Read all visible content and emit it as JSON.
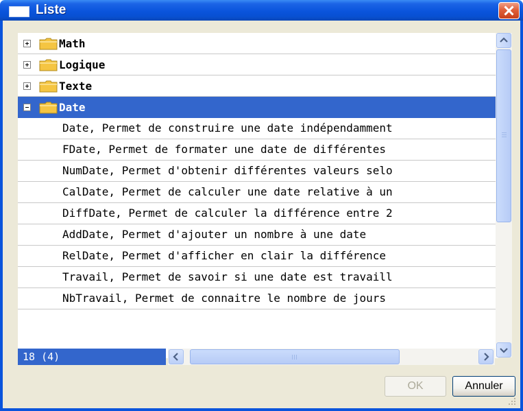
{
  "window": {
    "title": "Liste",
    "close_label": "Close"
  },
  "tree": {
    "categories": [
      {
        "label": "Math",
        "expanded": false
      },
      {
        "label": "Logique",
        "expanded": false
      },
      {
        "label": "Texte",
        "expanded": false
      },
      {
        "label": "Date",
        "expanded": true,
        "selected": true
      }
    ],
    "date_items": [
      "Date, Permet de construire une date indépendamment",
      "FDate, Permet de formater une date de différentes",
      "NumDate, Permet d'obtenir différentes valeurs selo",
      "CalDate, Permet de calculer une date relative à un",
      "DiffDate, Permet de calculer la différence entre 2",
      "AddDate, Permet d'ajouter un nombre à une date",
      "RelDate, Permet d'afficher en clair la différence",
      "Travail, Permet de savoir si une date est travaill",
      "NbTravail, Permet de connaitre le nombre de jours"
    ]
  },
  "status": {
    "count_text": "18 (4)"
  },
  "buttons": {
    "ok_label": "OK",
    "cancel_label": "Annuler"
  },
  "colors": {
    "title_bar": "#0a54dc",
    "selection": "#3366cc",
    "folder": "#f5c542",
    "close": "#e0603a"
  },
  "icons": {
    "title": "window-icon",
    "close": "close-x-icon",
    "folder": "folder-icon",
    "collapsed": "plus-box-icon",
    "expanded": "minus-box-icon"
  }
}
